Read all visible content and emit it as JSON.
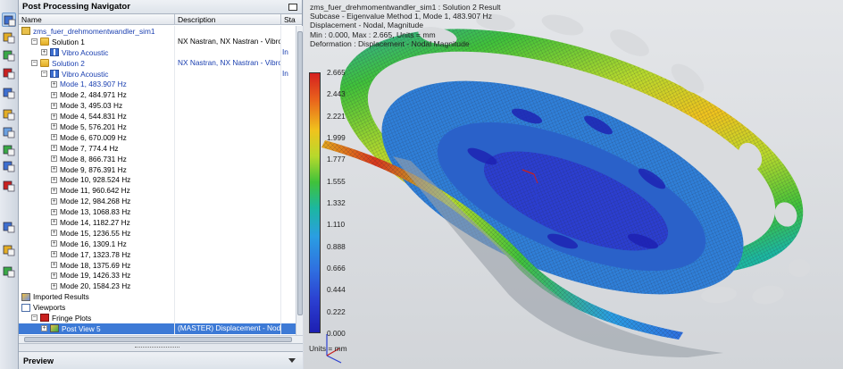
{
  "navigator": {
    "title": "Post Processing Navigator",
    "columns": {
      "name": "Name",
      "description": "Description",
      "status": "Stat"
    },
    "rows": [
      {
        "label": "zms_fuer_drehmomentwandler_sim1",
        "desc": "",
        "stat": "",
        "indent": 0,
        "icon": "sim-file-icon",
        "exp": "",
        "blue": true
      },
      {
        "label": "Solution 1",
        "desc": "NX Nastran, NX Nastran - Vibro...",
        "stat": "",
        "indent": 1,
        "icon": "folder-icon",
        "exp": "⊟",
        "blue": false
      },
      {
        "label": "Vibro Acoustic",
        "desc": "",
        "stat": "In",
        "indent": 2,
        "icon": "vibro-acoustic-icon",
        "exp": "⊞",
        "blue": true
      },
      {
        "label": "Solution 2",
        "desc": "NX Nastran, NX Nastran - Vibro...",
        "stat": "",
        "indent": 1,
        "icon": "folder-icon",
        "exp": "⊟",
        "blue": true
      },
      {
        "label": "Vibro Acoustic",
        "desc": "",
        "stat": "In",
        "indent": 2,
        "icon": "vibro-acoustic-icon",
        "exp": "⊟",
        "blue": true
      },
      {
        "label": "Mode 1, 483.907 Hz",
        "desc": "",
        "stat": "",
        "indent": 3,
        "icon": "",
        "exp": "⊞",
        "blue": true
      },
      {
        "label": "Mode 2, 484.971 Hz",
        "desc": "",
        "stat": "",
        "indent": 3,
        "icon": "",
        "exp": "⊞",
        "blue": false
      },
      {
        "label": "Mode 3, 495.03 Hz",
        "desc": "",
        "stat": "",
        "indent": 3,
        "icon": "",
        "exp": "⊞",
        "blue": false
      },
      {
        "label": "Mode 4, 544.831 Hz",
        "desc": "",
        "stat": "",
        "indent": 3,
        "icon": "",
        "exp": "⊞",
        "blue": false
      },
      {
        "label": "Mode 5, 576.201 Hz",
        "desc": "",
        "stat": "",
        "indent": 3,
        "icon": "",
        "exp": "⊞",
        "blue": false
      },
      {
        "label": "Mode 6, 670.009 Hz",
        "desc": "",
        "stat": "",
        "indent": 3,
        "icon": "",
        "exp": "⊞",
        "blue": false
      },
      {
        "label": "Mode 7, 774.4 Hz",
        "desc": "",
        "stat": "",
        "indent": 3,
        "icon": "",
        "exp": "⊞",
        "blue": false
      },
      {
        "label": "Mode 8, 866.731 Hz",
        "desc": "",
        "stat": "",
        "indent": 3,
        "icon": "",
        "exp": "⊞",
        "blue": false
      },
      {
        "label": "Mode 9, 876.391 Hz",
        "desc": "",
        "stat": "",
        "indent": 3,
        "icon": "",
        "exp": "⊞",
        "blue": false
      },
      {
        "label": "Mode 10, 928.524 Hz",
        "desc": "",
        "stat": "",
        "indent": 3,
        "icon": "",
        "exp": "⊞",
        "blue": false
      },
      {
        "label": "Mode 11, 960.642 Hz",
        "desc": "",
        "stat": "",
        "indent": 3,
        "icon": "",
        "exp": "⊞",
        "blue": false
      },
      {
        "label": "Mode 12, 984.268 Hz",
        "desc": "",
        "stat": "",
        "indent": 3,
        "icon": "",
        "exp": "⊞",
        "blue": false
      },
      {
        "label": "Mode 13, 1068.83 Hz",
        "desc": "",
        "stat": "",
        "indent": 3,
        "icon": "",
        "exp": "⊞",
        "blue": false
      },
      {
        "label": "Mode 14, 1182.27 Hz",
        "desc": "",
        "stat": "",
        "indent": 3,
        "icon": "",
        "exp": "⊞",
        "blue": false
      },
      {
        "label": "Mode 15, 1236.55 Hz",
        "desc": "",
        "stat": "",
        "indent": 3,
        "icon": "",
        "exp": "⊞",
        "blue": false
      },
      {
        "label": "Mode 16, 1309.1 Hz",
        "desc": "",
        "stat": "",
        "indent": 3,
        "icon": "",
        "exp": "⊞",
        "blue": false
      },
      {
        "label": "Mode 17, 1323.78 Hz",
        "desc": "",
        "stat": "",
        "indent": 3,
        "icon": "",
        "exp": "⊞",
        "blue": false
      },
      {
        "label": "Mode 18, 1375.69 Hz",
        "desc": "",
        "stat": "",
        "indent": 3,
        "icon": "",
        "exp": "⊞",
        "blue": false
      },
      {
        "label": "Mode 19, 1426.33 Hz",
        "desc": "",
        "stat": "",
        "indent": 3,
        "icon": "",
        "exp": "⊞",
        "blue": false
      },
      {
        "label": "Mode 20, 1584.23 Hz",
        "desc": "",
        "stat": "",
        "indent": 3,
        "icon": "",
        "exp": "⊞",
        "blue": false
      },
      {
        "label": "Imported Results",
        "desc": "",
        "stat": "",
        "indent": 0,
        "icon": "imported-results-icon",
        "exp": "",
        "blue": false
      },
      {
        "label": "Viewports",
        "desc": "",
        "stat": "",
        "indent": 0,
        "icon": "viewports-icon",
        "exp": "",
        "blue": false
      },
      {
        "label": "Fringe Plots",
        "desc": "",
        "stat": "",
        "indent": 1,
        "icon": "fringe-plot-icon",
        "exp": "⊟",
        "blue": false
      },
      {
        "label": "Post View 5",
        "desc": "(MASTER) Displacement - Noda...",
        "stat": "",
        "indent": 2,
        "icon": "post-view-icon",
        "exp": "⊞",
        "blue": false,
        "selected": true
      }
    ],
    "preview_label": "Preview"
  },
  "toolbar": {
    "icons": [
      "solution-icon",
      "mesh-icon",
      "element-icon",
      "fringe-icon",
      "deform-icon",
      "result-icon",
      "animation-icon",
      "display-icon",
      "graph-icon",
      "identify-icon",
      "clock-icon",
      "marker-icon",
      "color-bar-icon"
    ]
  },
  "viewport": {
    "header": [
      "zms_fuer_drehmomentwandler_sim1 : Solution 2 Result",
      "Subcase - Eigenvalue Method 1, Mode 1, 483.907 Hz",
      "Displacement - Nodal, Magnitude",
      "Min : 0.000, Max : 2.665, Units = mm",
      "Deformation : Displacement - Nodal Magnitude"
    ],
    "legend_values": [
      "2.665",
      "2.443",
      "2.221",
      "1.999",
      "1.777",
      "1.555",
      "1.332",
      "1.110",
      "0.888",
      "0.666",
      "0.444",
      "0.222",
      "0.000"
    ],
    "units_label": "Units = mm",
    "colors": {
      "max": "#d52020",
      "mid": "#40c23a",
      "min": "#1d1fb2",
      "background": "#d9dbde"
    }
  }
}
